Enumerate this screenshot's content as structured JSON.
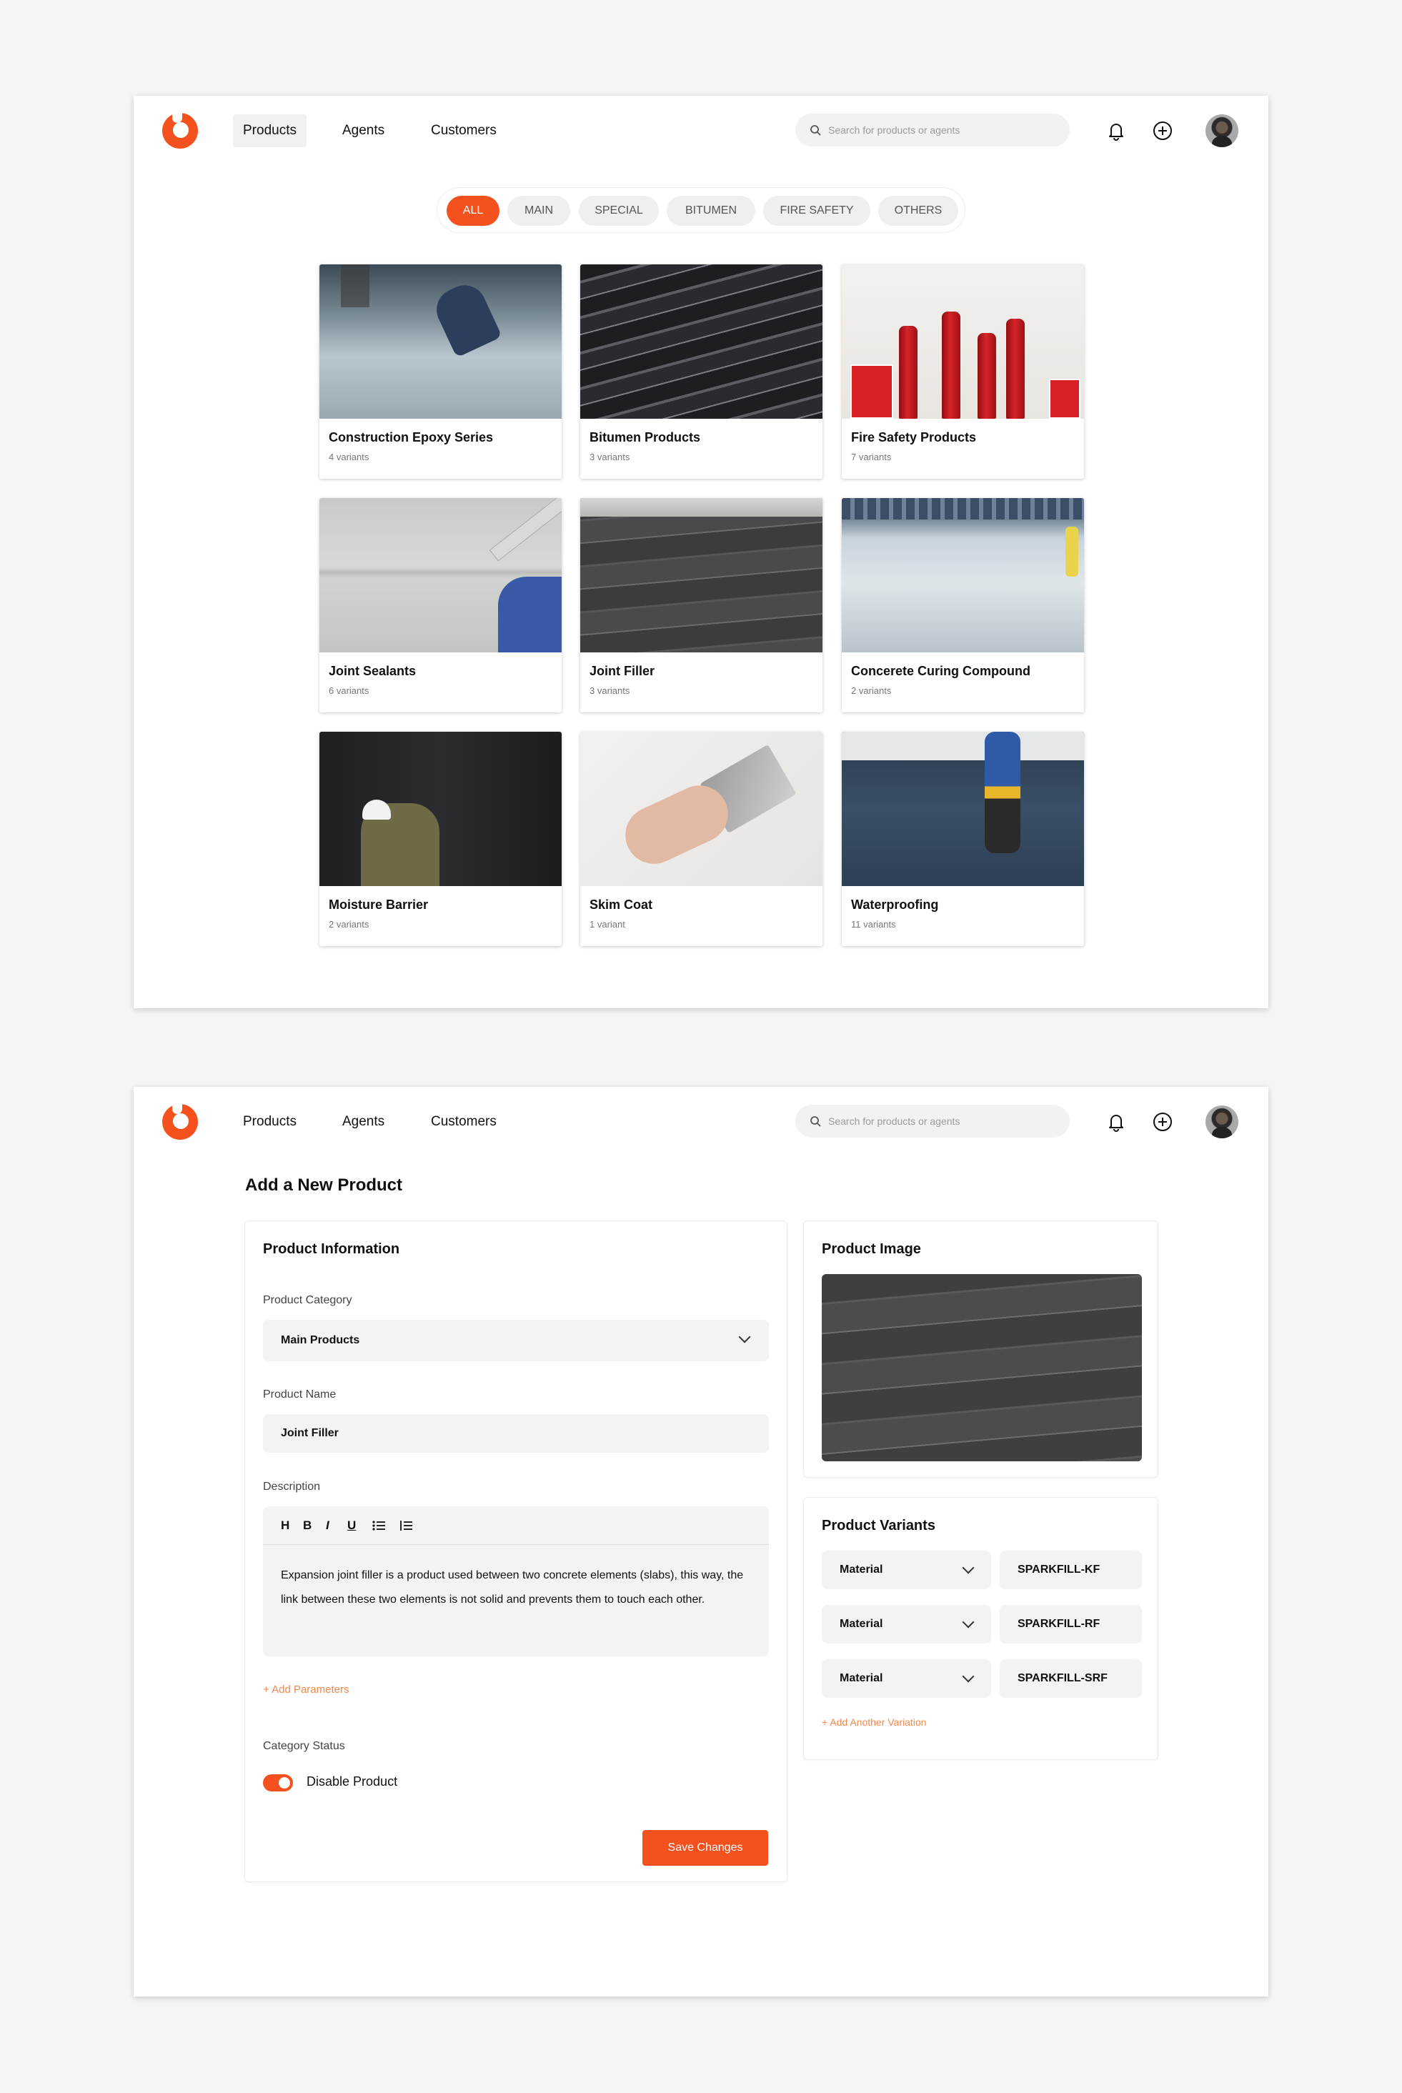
{
  "nav": {
    "products": "Products",
    "agents": "Agents",
    "customers": "Customers",
    "search_placeholder": "Search for products or agents"
  },
  "filters": [
    "ALL",
    "MAIN",
    "SPECIAL",
    "BITUMEN",
    "FIRE SAFETY",
    "OTHERS"
  ],
  "products": [
    {
      "name": "Construction Epoxy Series",
      "variants": "4 variants"
    },
    {
      "name": "Bitumen Products",
      "variants": "3 variants"
    },
    {
      "name": "Fire Safety Products",
      "variants": "7 variants"
    },
    {
      "name": "Joint Sealants",
      "variants": "6 variants"
    },
    {
      "name": "Joint Filler",
      "variants": "3 variants"
    },
    {
      "name": "Concerete Curing Compound",
      "variants": "2 variants"
    },
    {
      "name": "Moisture Barrier",
      "variants": "2 variants"
    },
    {
      "name": "Skim Coat",
      "variants": "1 variant"
    },
    {
      "name": "Waterproofing",
      "variants": "11 variants"
    }
  ],
  "form": {
    "page_title": "Add a New Product",
    "info_title": "Product Information",
    "category_label": "Product Category",
    "category_value": "Main Products",
    "name_label": "Product Name",
    "name_value": "Joint Filler",
    "description_label": "Description",
    "toolbar": [
      "H",
      "B",
      "I",
      "U"
    ],
    "description_text": "Expansion joint filler is a product used between two concrete elements (slabs), this way, the link between these two elements is not solid and prevents them to touch each other.",
    "add_parameters": "+ Add Parameters",
    "status_label": "Category Status",
    "toggle_label": "Disable Product",
    "save_button": "Save Changes",
    "image_title": "Product Image",
    "variants_title": "Product Variants",
    "variants": [
      {
        "type": "Material",
        "code": "SPARKFILL-KF"
      },
      {
        "type": "Material",
        "code": "SPARKFILL-RF"
      },
      {
        "type": "Material",
        "code": "SPARKFILL-SRF"
      }
    ],
    "add_variation": "+ Add Another Variation"
  },
  "colors": {
    "accent": "#f4511e",
    "accent_light": "#f4874a",
    "field_bg": "#f3f3f3"
  }
}
